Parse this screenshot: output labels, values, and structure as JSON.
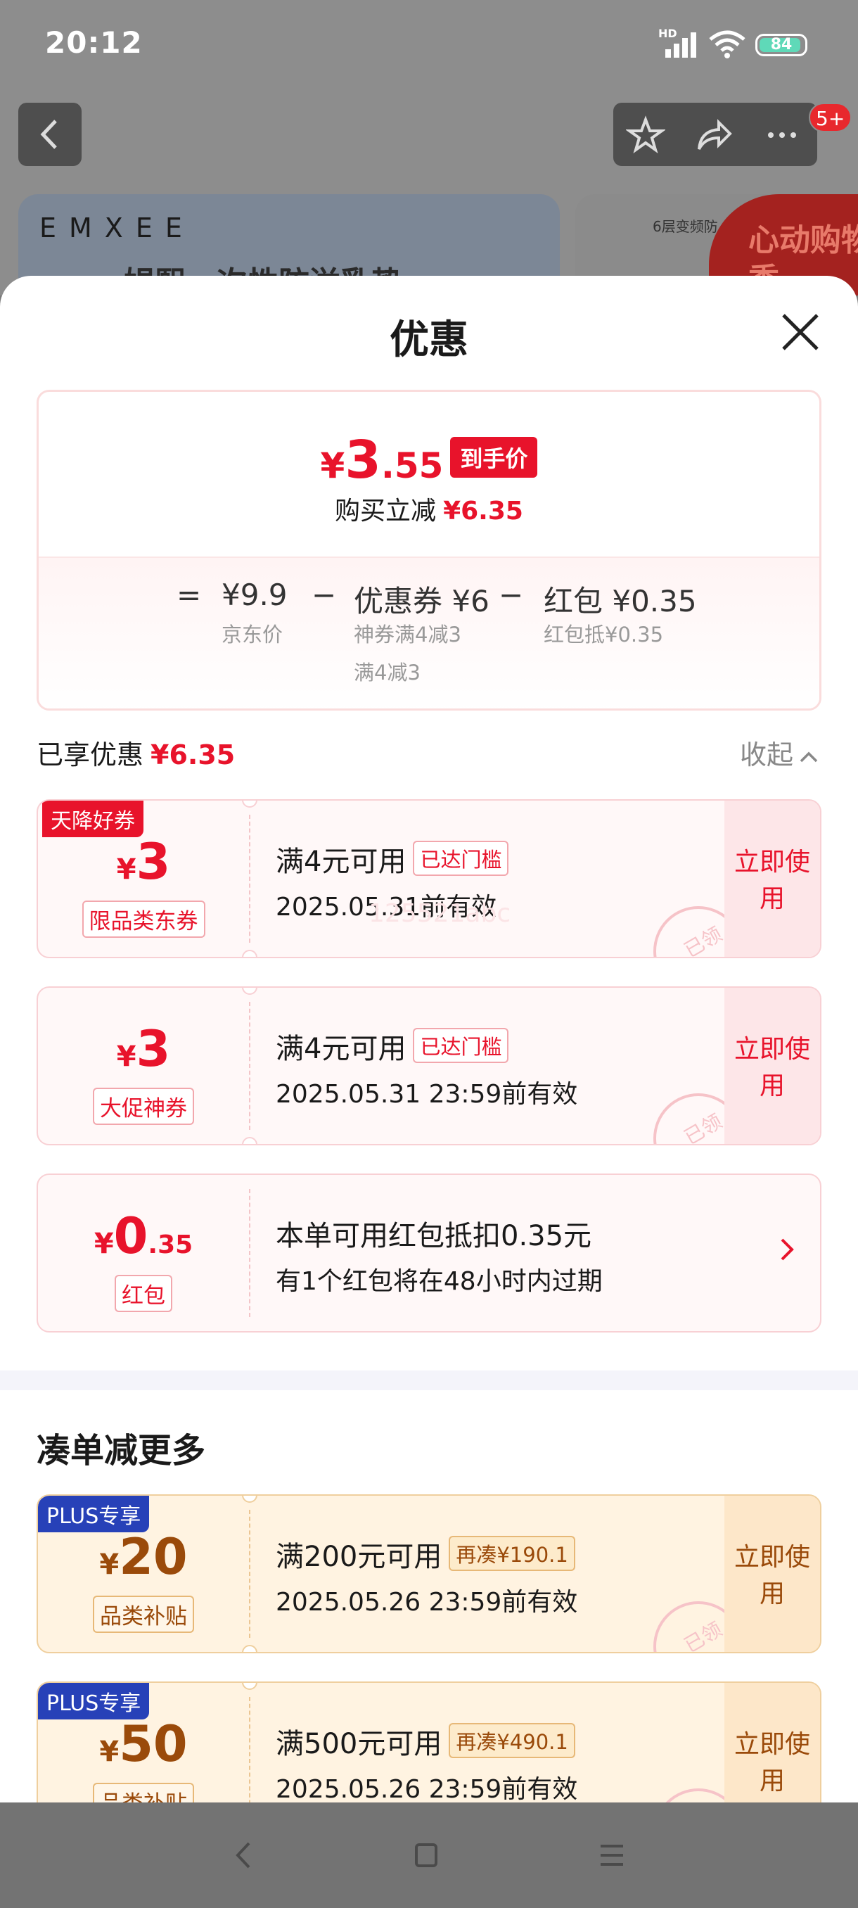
{
  "status_bar": {
    "time": "20:12",
    "network": "HD",
    "battery": "84"
  },
  "top_bar": {
    "badge": "5+"
  },
  "background": {
    "brand": "EMXEE",
    "headline": "娼熙一次性防溢乳垫",
    "card2_text": "6层变频防",
    "card2_promo": "心动购物季"
  },
  "sheet": {
    "title": "优惠",
    "summary": {
      "final_yen": "¥",
      "final_int": "3",
      "final_dec": ".55",
      "final_tag": "到手价",
      "reduce_label": "购买立减",
      "reduce_amount": "¥6.35",
      "formula": {
        "eq": "=",
        "jd_price": "¥9.9",
        "jd_label": "京东价",
        "minus": "−",
        "coupon_price": "优惠券 ¥6",
        "coupon_sub1": "神券满4减3",
        "coupon_sub2": "满4减3",
        "redpacket_price": "红包 ¥0.35",
        "redpacket_sub": "红包抵¥0.35"
      }
    },
    "enjoyed": {
      "label": "已享优惠",
      "amount": "¥6.35",
      "collapse": "收起"
    },
    "coupons": [
      {
        "ribbon": "天降好券",
        "yen": "¥",
        "amount": "3",
        "kind": "限品类东券",
        "condition": "满4元可用",
        "chip": "已达门槛",
        "expiry": "2025.05.31前有效",
        "use": "立即使用",
        "stamp": "已领",
        "watermark": "125521abc"
      },
      {
        "yen": "¥",
        "amount": "3",
        "kind": "大促神券",
        "condition": "满4元可用",
        "chip": "已达门槛",
        "expiry": "2025.05.31 23:59前有效",
        "use": "立即使用",
        "stamp": "已领"
      },
      {
        "yen": "¥",
        "amount": "0",
        "amount_small": ".35",
        "kind": "红包",
        "condition": "本单可用红包抵扣0.35元",
        "expiry": "有1个红包将在48小时内过期"
      }
    ],
    "more": {
      "title": "凑单减更多",
      "coupons": [
        {
          "ribbon": "PLUS专享",
          "yen": "¥",
          "amount": "20",
          "kind": "品类补贴",
          "condition": "满200元可用",
          "chip": "再凑¥190.1",
          "expiry": "2025.05.26 23:59前有效",
          "use": "立即使用",
          "stamp": "已领"
        },
        {
          "ribbon": "PLUS专享",
          "yen": "¥",
          "amount": "50",
          "kind": "品类补贴",
          "condition": "满500元可用",
          "chip": "再凑¥490.1",
          "expiry": "2025.05.26 23:59前有效",
          "use": "立即使用",
          "stamp": "已领"
        }
      ]
    }
  },
  "nav_icons": [
    "back-icon",
    "home-icon",
    "menu-icon"
  ],
  "colors": {
    "accent_red": "#e8132b",
    "plus_blue": "#2741b8",
    "plus_brown": "#9a4a0a"
  }
}
